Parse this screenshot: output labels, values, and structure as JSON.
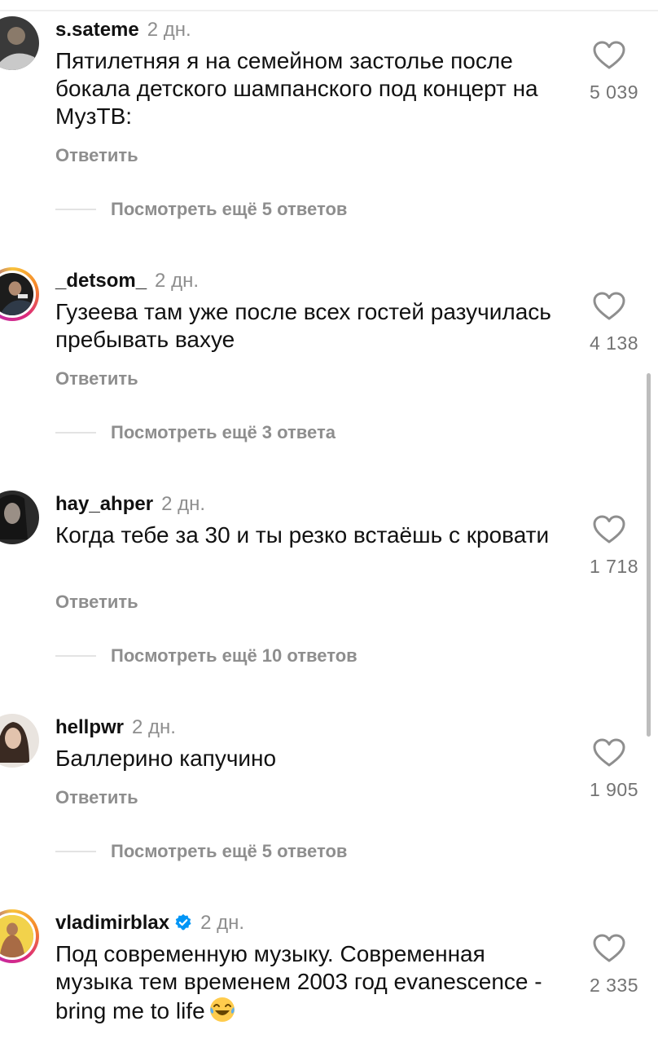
{
  "comments": [
    {
      "username": "s.sateme",
      "time": "2 дн.",
      "text": "Пятилетняя я на семейном застолье после бокала детского шампанского под концерт на МузТВ:",
      "likes": "5 039",
      "reply_label": "Ответить",
      "more_replies": "Посмотреть ещё 5 ответов",
      "verified": false,
      "story_ring": false
    },
    {
      "username": "_detsom_",
      "time": "2 дн.",
      "text": "Гузеева там уже после всех гостей разучилась пребывать вахуе",
      "likes": "4 138",
      "reply_label": "Ответить",
      "more_replies": "Посмотреть ещё 3 ответа",
      "verified": false,
      "story_ring": true
    },
    {
      "username": "hay_ahper",
      "time": "2 дн.",
      "text": "Когда тебе за 30 и ты резко встаёшь с кровати",
      "likes": "1 718",
      "reply_label": "Ответить",
      "more_replies": "Посмотреть ещё 10 ответов",
      "verified": false,
      "story_ring": false
    },
    {
      "username": "hellpwr",
      "time": "2 дн.",
      "text": "Баллерино капучино",
      "likes": "1 905",
      "reply_label": "Ответить",
      "more_replies": "Посмотреть ещё 5 ответов",
      "verified": false,
      "story_ring": false
    },
    {
      "username": "vladimirblax",
      "time": "2 дн.",
      "text": "Под современную музыку. Современная музыка тем временем 2003 год evanescence - bring me to life",
      "emoji": "tears-of-joy-emoji",
      "likes": "2 335",
      "verified": true,
      "story_ring": true
    }
  ],
  "icons": {
    "like": "heart-outline-icon",
    "verified": "verified-badge-icon"
  },
  "colors": {
    "verified": "#0095f6",
    "meta_text": "#8e8e8e"
  }
}
